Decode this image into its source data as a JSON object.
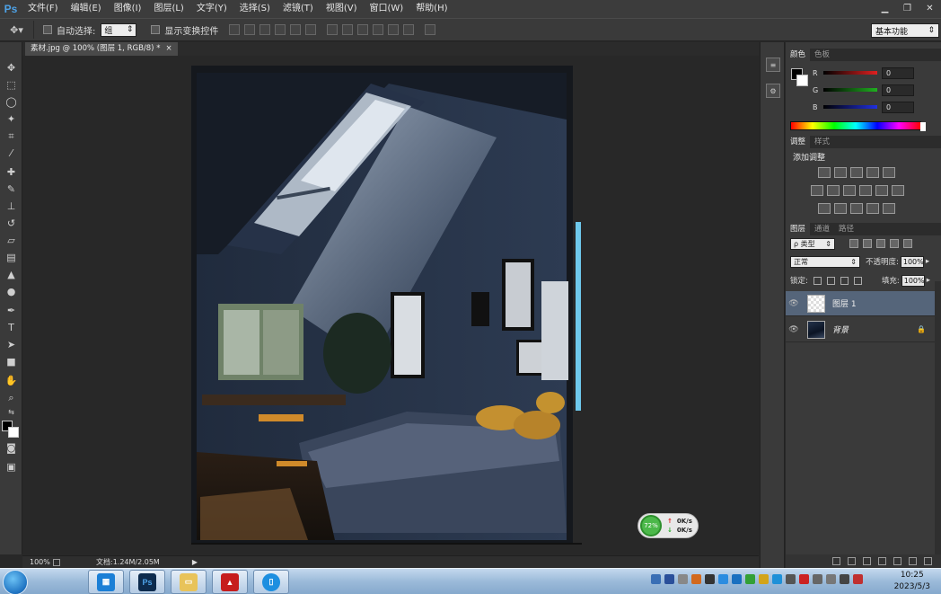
{
  "app": {
    "logo": "Ps",
    "menu": [
      "文件(F)",
      "编辑(E)",
      "图像(I)",
      "图层(L)",
      "文字(Y)",
      "选择(S)",
      "滤镜(T)",
      "视图(V)",
      "窗口(W)",
      "帮助(H)"
    ],
    "window_controls": [
      "minimize-icon",
      "restore-icon",
      "close-icon"
    ]
  },
  "options": {
    "tool_icon": "move-tool-icon",
    "auto_select_label": "自动选择:",
    "auto_select_value": "组",
    "show_transform_label": "显示变换控件",
    "workspace": "基本功能"
  },
  "document": {
    "tab_title": "素材.jpg @ 100% (图层 1, RGB/8) *",
    "tab_close": "×",
    "zoom": "100%",
    "doc_info": "文档:1.24M/2.05M"
  },
  "netmeter": {
    "percent": "72%",
    "up_rate": "0K/s",
    "down_rate": "0K/s"
  },
  "color_panel": {
    "tabs": [
      "颜色",
      "色板"
    ],
    "channels": [
      {
        "label": "R",
        "value": "0",
        "color": "#e02020"
      },
      {
        "label": "G",
        "value": "0",
        "color": "#20b020"
      },
      {
        "label": "B",
        "value": "0",
        "color": "#2030e0"
      }
    ]
  },
  "adjust_panel": {
    "tabs": [
      "调整",
      "样式"
    ],
    "title": "添加调整"
  },
  "layers_panel": {
    "tabs": [
      "图层",
      "通道",
      "路径"
    ],
    "filter_label": "ρ 类型",
    "blend_mode": "正常",
    "opacity_label": "不透明度:",
    "opacity_value": "100%",
    "lock_label": "锁定:",
    "fill_label": "填充:",
    "fill_value": "100%",
    "layers": [
      {
        "name": "图层 1",
        "selected": true
      },
      {
        "name": "背景",
        "selected": false,
        "locked": true
      }
    ]
  },
  "taskbar": {
    "apps": [
      "windows-store-icon",
      "photoshop-icon",
      "file-explorer-icon",
      "acrobat-icon",
      "phone-app-icon"
    ],
    "ps_label": "Ps",
    "time": "10:25",
    "date": "2023/5/3"
  }
}
